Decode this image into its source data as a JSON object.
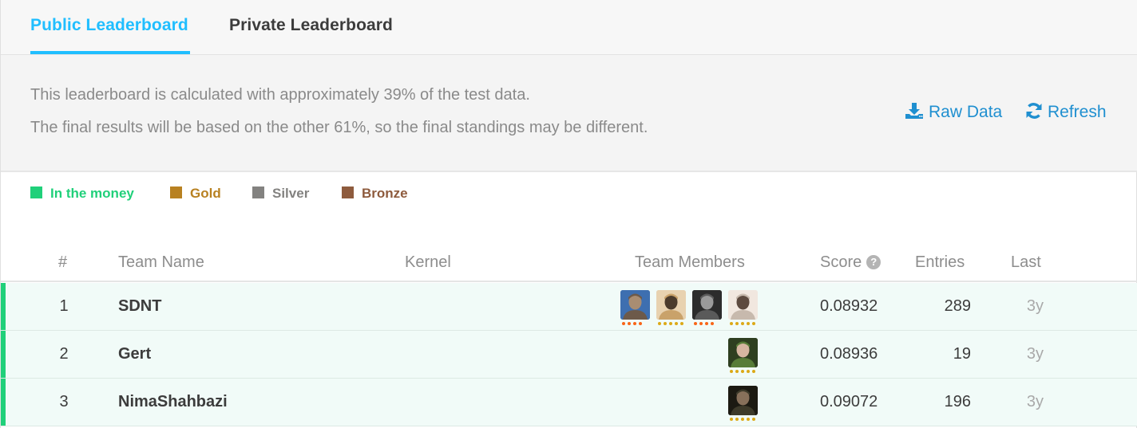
{
  "tabs": {
    "public": "Public Leaderboard",
    "private": "Private Leaderboard"
  },
  "info": {
    "line1": "This leaderboard is calculated with approximately 39% of the test data.",
    "line2": "The final results will be based on the other 61%, so the final standings may be different.",
    "raw_data": "Raw Data",
    "refresh": "Refresh",
    "raw_icon": "download-icon",
    "refresh_icon": "refresh-icon"
  },
  "legend": [
    {
      "label": "In the money",
      "color": "#20d07a"
    },
    {
      "label": "Gold",
      "color": "#b88121"
    },
    {
      "label": "Silver",
      "color": "#838280"
    },
    {
      "label": "Bronze",
      "color": "#8e5b3d"
    }
  ],
  "table": {
    "headers": {
      "rank": "#",
      "team": "Team Name",
      "kernel": "Kernel",
      "members": "Team Members",
      "score": "Score",
      "entries": "Entries",
      "last": "Last"
    },
    "score_help_icon": "question-circle-icon",
    "rows": [
      {
        "rank": "1",
        "team": "SDNT",
        "score": "0.08932",
        "entries": "289",
        "last": "3y",
        "members": [
          {
            "avatar": "avatar-photo",
            "tier": "master",
            "tier_color": "#f96517"
          },
          {
            "avatar": "avatar-photo",
            "tier": "grandmaster",
            "tier_color": "#dca917"
          },
          {
            "avatar": "avatar-photo",
            "tier": "master",
            "tier_color": "#f96517"
          },
          {
            "avatar": "avatar-photo",
            "tier": "grandmaster",
            "tier_color": "#dca917"
          }
        ]
      },
      {
        "rank": "2",
        "team": "Gert",
        "score": "0.08936",
        "entries": "19",
        "last": "3y",
        "members": [
          {
            "avatar": "avatar-photo",
            "tier": "grandmaster",
            "tier_color": "#dca917"
          }
        ]
      },
      {
        "rank": "3",
        "team": "NimaShahbazi",
        "score": "0.09072",
        "entries": "196",
        "last": "3y",
        "members": [
          {
            "avatar": "avatar-photo",
            "tier": "grandmaster",
            "tier_color": "#dca917"
          }
        ]
      }
    ]
  },
  "colors": {
    "accent": "#20beff",
    "link": "#1f8fd0",
    "in_the_money": "#20d07a",
    "row_bg": "#f1fbf8"
  }
}
